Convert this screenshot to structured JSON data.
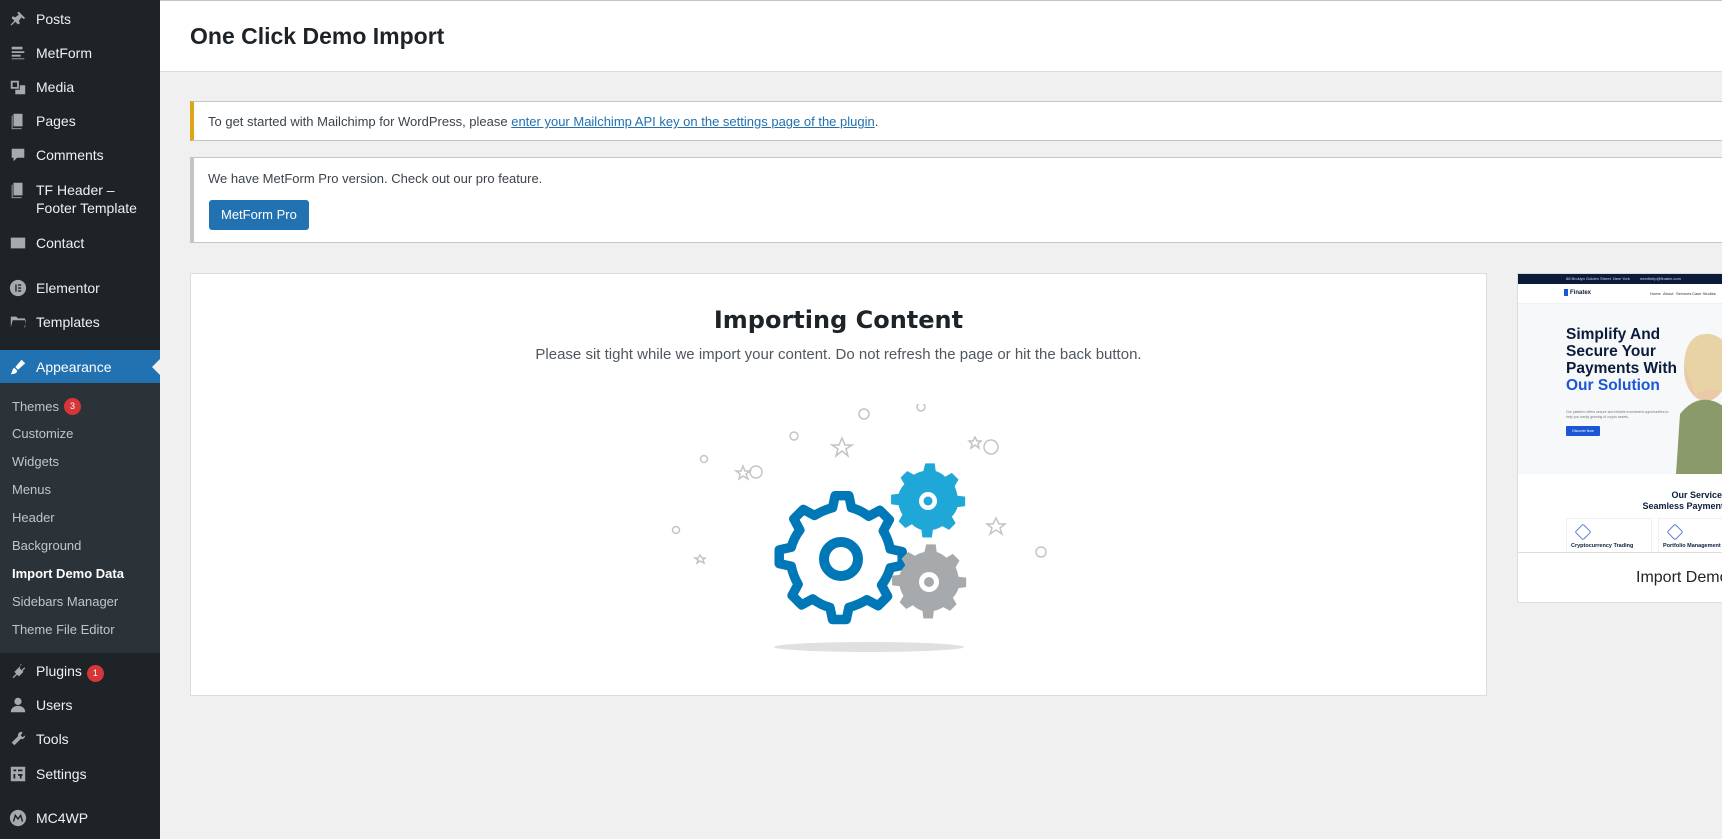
{
  "sidebar": {
    "items": [
      {
        "label": "Posts",
        "icon": "pushpin-icon"
      },
      {
        "label": "MetForm",
        "icon": "form-icon"
      },
      {
        "label": "Media",
        "icon": "media-icon"
      },
      {
        "label": "Pages",
        "icon": "pages-icon"
      },
      {
        "label": "Comments",
        "icon": "comment-icon"
      },
      {
        "label": "TF Header –",
        "label2": "Footer Template",
        "icon": "pages-icon"
      },
      {
        "label": "Contact",
        "icon": "envelope-icon"
      },
      {
        "label": "Elementor",
        "icon": "elementor-icon"
      },
      {
        "label": "Templates",
        "icon": "folder-icon"
      },
      {
        "label": "Appearance",
        "icon": "paintbrush-icon"
      },
      {
        "label": "Plugins",
        "icon": "plugin-icon",
        "badge": "1"
      },
      {
        "label": "Users",
        "icon": "user-icon"
      },
      {
        "label": "Tools",
        "icon": "wrench-icon"
      },
      {
        "label": "Settings",
        "icon": "settings-icon"
      },
      {
        "label": "MC4WP",
        "icon": "mc4wp-icon"
      }
    ],
    "submenu": [
      {
        "label": "Themes",
        "badge": "3"
      },
      {
        "label": "Customize"
      },
      {
        "label": "Widgets"
      },
      {
        "label": "Menus"
      },
      {
        "label": "Header"
      },
      {
        "label": "Background"
      },
      {
        "label": "Import Demo Data"
      },
      {
        "label": "Sidebars Manager"
      },
      {
        "label": "Theme File Editor"
      }
    ]
  },
  "header": {
    "title": "One Click Demo Import"
  },
  "notices": {
    "mailchimp": {
      "text_before": "To get started with Mailchimp for WordPress, please ",
      "link": "enter your Mailchimp API key on the settings page of the plugin",
      "text_after": "."
    },
    "metform": {
      "text": "We have MetForm Pro version. Check out our pro feature.",
      "button": "MetForm Pro"
    }
  },
  "import": {
    "title": "Importing Content",
    "subtitle": "Please sit tight while we import your content. Do not refresh the page or hit the back button."
  },
  "preview": {
    "label": "Import Demo",
    "topbar_address": "88 Broklyn Golden Street. New York",
    "topbar_email": "needhelp@finatex.com",
    "logo": "Finatex",
    "nav": [
      "Home",
      "About",
      "Services",
      "Case Studies"
    ],
    "hero_lines": [
      "Simplify And",
      "Secure Your",
      "Payments With"
    ],
    "hero_highlight": "Our Solution",
    "hero_text": "Our platform offers secure and reliable investment opportunities to help you easily growing of crypto assets.",
    "hero_button": "Discover Now",
    "section_title_1": "Our Services",
    "section_title_2": "Seamless Payments",
    "cards": [
      "Cryptocurrency Trading",
      "Portfolio Management"
    ]
  },
  "colors": {
    "sidebar_bg": "#1d2327",
    "active_bg": "#2271b1",
    "gear_blue": "#0077b6",
    "gear_cyan": "#1fa7d8",
    "gear_gray": "#a7aaad"
  }
}
